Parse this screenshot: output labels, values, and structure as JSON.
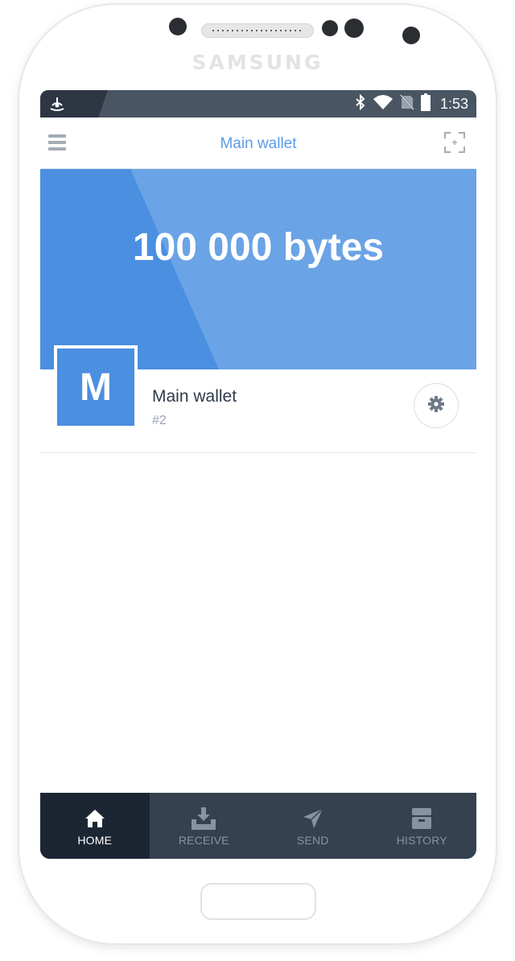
{
  "device": {
    "brand": "SAMSUNG"
  },
  "status_bar": {
    "time": "1:53",
    "icons": [
      "app-notification-icon",
      "bluetooth-icon",
      "wifi-icon",
      "no-sim-icon",
      "battery-icon"
    ]
  },
  "app_bar": {
    "title": "Main wallet",
    "left_icon": "menu-icon",
    "right_icon": "scan-icon"
  },
  "balance": {
    "text": "100 000 bytes"
  },
  "wallet": {
    "avatar_letter": "M",
    "name": "Main wallet",
    "number": "#2",
    "settings_icon": "gear-icon"
  },
  "tabs": [
    {
      "label": "HOME",
      "icon": "home-icon",
      "active": true
    },
    {
      "label": "RECEIVE",
      "icon": "download-icon",
      "active": false
    },
    {
      "label": "SEND",
      "icon": "paper-plane-icon",
      "active": false
    },
    {
      "label": "HISTORY",
      "icon": "archive-icon",
      "active": false
    }
  ],
  "colors": {
    "accent": "#5b9be6",
    "hero_light": "#6aa3e6",
    "hero_dark": "#4a8fe0",
    "tabbar": "#35414f",
    "tabbar_active": "#1c2633",
    "statusbar": "#4a5563"
  }
}
